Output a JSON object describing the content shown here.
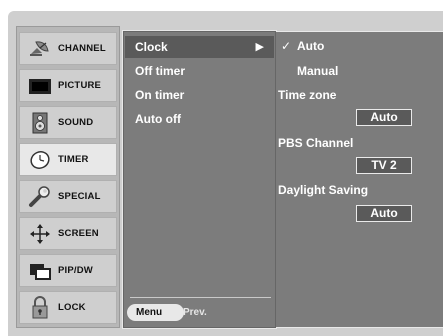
{
  "sidebar": {
    "items": [
      {
        "label": "CHANNEL",
        "icon": "satellite-dish-icon"
      },
      {
        "label": "PICTURE",
        "icon": "monitor-icon"
      },
      {
        "label": "SOUND",
        "icon": "speaker-icon"
      },
      {
        "label": "TIMER",
        "icon": "clock-icon"
      },
      {
        "label": "SPECIAL",
        "icon": "wrench-icon"
      },
      {
        "label": "SCREEN",
        "icon": "move-arrows-icon"
      },
      {
        "label": "PIP/DW",
        "icon": "pip-window-icon"
      },
      {
        "label": "LOCK",
        "icon": "padlock-icon"
      }
    ],
    "active_index": 3
  },
  "middle": {
    "items": [
      {
        "label": "Clock",
        "arrow": "▶"
      },
      {
        "label": "Off timer"
      },
      {
        "label": "On timer"
      },
      {
        "label": "Auto off"
      }
    ],
    "selected_index": 0,
    "footer": {
      "menu_label": "Menu",
      "prev_label": "Prev."
    }
  },
  "right": {
    "options": [
      {
        "label": "Auto",
        "checked": true,
        "check_mark": "✓"
      },
      {
        "label": "Manual",
        "checked": false
      }
    ],
    "settings": [
      {
        "label": "Time zone",
        "value": "Auto"
      },
      {
        "label": "PBS Channel",
        "value": "TV 2"
      },
      {
        "label": "Daylight Saving",
        "value": "Auto"
      }
    ]
  },
  "colors": {
    "background": "#cfcfcf",
    "panel": "#7c7c7c",
    "selected": "#5a5a5a",
    "sidebar_active": "#e8e8e8",
    "text_light": "#ffffff"
  }
}
